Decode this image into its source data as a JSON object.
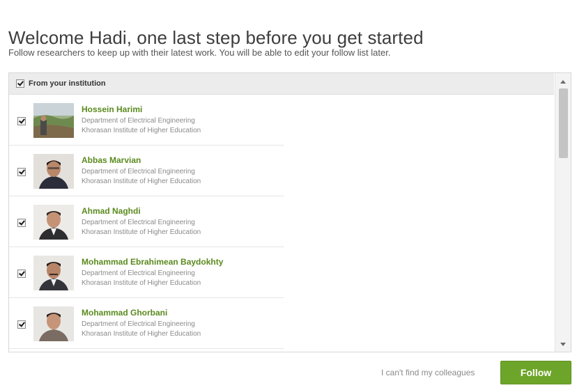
{
  "header": {
    "title": "Welcome Hadi, one last step before you get started",
    "subtitle": "Follow researchers to keep up with their latest work. You will be able to edit your follow list later."
  },
  "panel": {
    "header_label": "From your institution",
    "header_checked": true
  },
  "researchers": [
    {
      "name": "Hossein Harimi",
      "department": "Department of Electrical Engineering",
      "institution": "Khorasan Institute of Higher Education",
      "checked": true
    },
    {
      "name": "Abbas Marvian",
      "department": "Department of Electrical Engineering",
      "institution": "Khorasan Institute of Higher Education",
      "checked": true
    },
    {
      "name": "Ahmad Naghdi",
      "department": "Department of Electrical Engineering",
      "institution": "Khorasan Institute of Higher Education",
      "checked": true
    },
    {
      "name": "Mohammad Ebrahimean Baydokhty",
      "department": "Department of Electrical Engineering",
      "institution": "Khorasan Institute of Higher Education",
      "checked": true
    },
    {
      "name": "Mohammad Ghorbani",
      "department": "Department of Electrical Engineering",
      "institution": "Khorasan Institute of Higher Education",
      "checked": true
    }
  ],
  "footer": {
    "cant_find_label": "I can't find my colleagues",
    "follow_label": "Follow"
  },
  "colors": {
    "accent": "#6da52a",
    "name_link": "#5a8a1e"
  }
}
